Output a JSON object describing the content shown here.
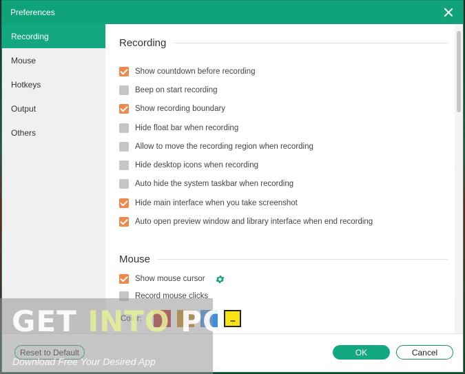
{
  "window": {
    "title": "Preferences"
  },
  "sidebar": {
    "items": [
      {
        "label": "Recording",
        "active": true
      },
      {
        "label": "Mouse"
      },
      {
        "label": "Hotkeys"
      },
      {
        "label": "Output"
      },
      {
        "label": "Others"
      }
    ]
  },
  "recording": {
    "title": "Recording",
    "options": [
      {
        "label": "Show countdown before recording",
        "checked": true
      },
      {
        "label": "Beep on start recording",
        "checked": false
      },
      {
        "label": "Show recording boundary",
        "checked": true
      },
      {
        "label": "Hide float bar when recording",
        "checked": false
      },
      {
        "label": "Allow to move the recording region when recording",
        "checked": false
      },
      {
        "label": "Hide desktop icons when recording",
        "checked": false
      },
      {
        "label": "Auto hide the system taskbar when recording",
        "checked": false
      },
      {
        "label": "Hide main interface when you take screenshot",
        "checked": true
      },
      {
        "label": "Auto open preview window and library interface when end recording",
        "checked": true
      }
    ]
  },
  "mouse": {
    "title": "Mouse",
    "show_cursor_label": "Show mouse cursor",
    "show_cursor_checked": true,
    "record_clicks_label": "Record mouse clicks",
    "record_clicks_checked": false,
    "color_label": "Color:",
    "swatches": [
      "#c0282a",
      "#c98a12",
      "#3d8ee0"
    ],
    "more_label": "...",
    "more_color": "#f7e417"
  },
  "footer": {
    "reset_label": "Reset to Default",
    "ok_label": "OK",
    "cancel_label": "Cancel"
  },
  "watermark": {
    "get": "GET ",
    "into": "INTO",
    "pc": " PC",
    "tagline": "Download Free Your Desired App"
  },
  "colors": {
    "accent": "#13a880",
    "checkbox_on": "#f0874b",
    "checkbox_off": "#c6c6c6"
  }
}
